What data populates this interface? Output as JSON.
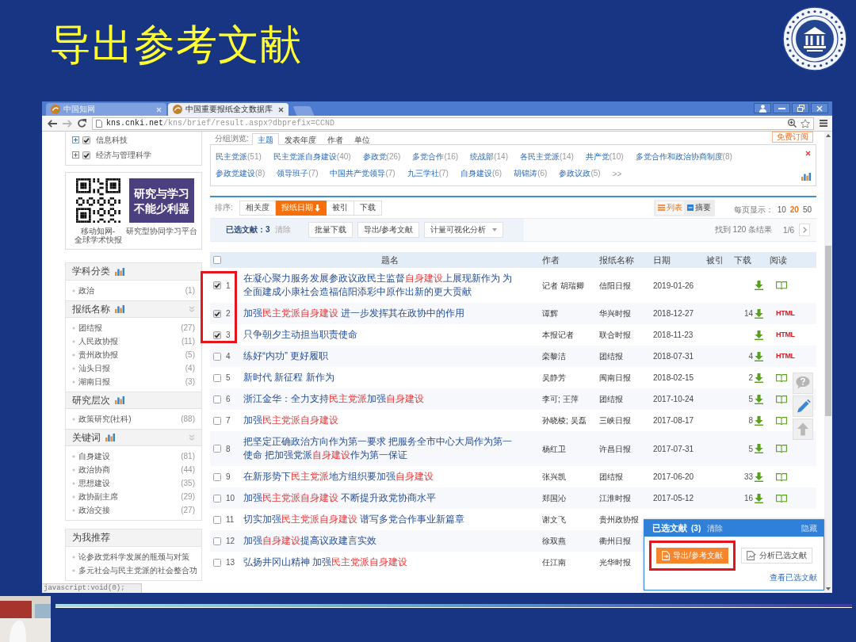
{
  "slide": {
    "title": "导出参考文献"
  },
  "browser": {
    "tabs": [
      {
        "title": "中国知网",
        "selected": false
      },
      {
        "title": "中国重要报纸全文数据库",
        "selected": true
      }
    ],
    "url": {
      "host": "kns.cnki.net",
      "path": "/kns/brief/result.aspx?dbprefix=CCND"
    },
    "status_text": "javascript:void(0);"
  },
  "sidebar": {
    "categories": [
      {
        "label": "信息科技",
        "checked": true
      },
      {
        "label": "经济与管理科学",
        "checked": true
      }
    ],
    "promo": {
      "qr_caption": [
        "移动知网-",
        "全球学术快报"
      ],
      "banner": [
        "研究与学习",
        "不能少利器"
      ],
      "banner_caption": "研究型协同学习平台"
    },
    "facets": [
      {
        "title": "学科分类",
        "toggle": false,
        "items": [
          {
            "label": "政治",
            "count": "(1)"
          }
        ]
      },
      {
        "title": "报纸名称",
        "toggle": true,
        "items": [
          {
            "label": "团结报",
            "count": "(27)"
          },
          {
            "label": "人民政协报",
            "count": "(11)"
          },
          {
            "label": "贵州政协报",
            "count": "(5)"
          },
          {
            "label": "汕头日报",
            "count": "(4)"
          },
          {
            "label": "湖南日报",
            "count": "(3)"
          }
        ]
      },
      {
        "title": "研究层次",
        "toggle": false,
        "items": [
          {
            "label": "政策研究(社科)",
            "count": "(88)"
          }
        ]
      },
      {
        "title": "关键词",
        "toggle": true,
        "items": [
          {
            "label": "自身建设",
            "count": "(81)"
          },
          {
            "label": "政治协商",
            "count": "(44)"
          },
          {
            "label": "思想建设",
            "count": "(35)"
          },
          {
            "label": "政协副主席",
            "count": "(29)"
          },
          {
            "label": "政治交接",
            "count": "(27)"
          }
        ]
      }
    ],
    "recommend": {
      "title": "为我推荐",
      "items": [
        "论参政党科学发展的瓶颈与对策",
        "多元社会与民主党派的社会整合功"
      ]
    }
  },
  "group_browse": {
    "label": "分组浏览:",
    "tabs": [
      {
        "label": "主题",
        "selected": true
      },
      {
        "label": "发表年度",
        "selected": false
      },
      {
        "label": "作者",
        "selected": false
      },
      {
        "label": "单位",
        "selected": false
      }
    ],
    "subscribe": "免费订阅"
  },
  "topics": {
    "rows": [
      [
        {
          "label": "民主党派",
          "count": "(51)"
        },
        {
          "label": "民主党派自身建设",
          "count": "(40)"
        },
        {
          "label": "参政党",
          "count": "(26)"
        },
        {
          "label": "多党合作",
          "count": "(16)"
        },
        {
          "label": "统战部",
          "count": "(14)"
        },
        {
          "label": "各民主党派",
          "count": "(14)"
        },
        {
          "label": "共产党",
          "count": "(10)"
        },
        {
          "label": "多党合作和政治协商制度",
          "count": "(8)"
        }
      ],
      [
        {
          "label": "参政党建设",
          "count": "(8)"
        },
        {
          "label": "领导班子",
          "count": "(7)"
        },
        {
          "label": "中国共产党领导",
          "count": "(7)"
        },
        {
          "label": "九三学社",
          "count": "(7)"
        },
        {
          "label": "自身建设",
          "count": "(6)"
        },
        {
          "label": "胡锦涛",
          "count": "(6)"
        },
        {
          "label": "参政议政",
          "count": "(5)"
        }
      ]
    ],
    "more": ">>"
  },
  "sort": {
    "label": "排序:",
    "options": [
      {
        "label": "相关度",
        "selected": false
      },
      {
        "label": "报纸日期",
        "selected": true
      },
      {
        "label": "被引",
        "selected": false
      },
      {
        "label": "下载",
        "selected": false
      }
    ]
  },
  "views": [
    {
      "label": "列表",
      "kind": "list",
      "selected": true
    },
    {
      "label": "摘要",
      "kind": "abstract",
      "selected": false
    }
  ],
  "page_size": {
    "label": "每页显示：",
    "options": [
      {
        "label": "10",
        "selected": false
      },
      {
        "label": "20",
        "selected": true
      },
      {
        "label": "50",
        "selected": false
      }
    ]
  },
  "selection": {
    "label": "已选文献：3",
    "clear": "清除",
    "actions": [
      {
        "label": "批量下载",
        "dropdown": false
      },
      {
        "label": "导出/参考文献",
        "dropdown": false
      },
      {
        "label": "计量可视化分析",
        "dropdown": true
      }
    ],
    "results": "找到 120 条结果",
    "page": "1/6"
  },
  "table": {
    "columns": [
      "题名",
      "作者",
      "报纸名称",
      "日期",
      "被引",
      "下载",
      "阅读"
    ],
    "all_checked": false,
    "rows": [
      {
        "no": "1",
        "checked": true,
        "framed": true,
        "title": "在凝心聚力服务发展参政议政民主监督**自身建设**上展现新作为 为全面建成小康社会造福信阳添彩中原作出新的更大贡献",
        "author": "记者 胡瑞卿",
        "paper": "信阳日报",
        "date": "2019-01-26",
        "downloadable": true,
        "read": {
          "kind": "book"
        }
      },
      {
        "no": "2",
        "checked": true,
        "framed": true,
        "title": "加强**民主党派自身建设** 进一步发挥其在政协中的作用",
        "author": "谭辉",
        "paper": "华兴时报",
        "date": "2018-12-27",
        "downloads": "14",
        "downloadable": true,
        "read": {
          "kind": "html",
          "label": "HTML"
        }
      },
      {
        "no": "3",
        "checked": true,
        "framed": true,
        "title": "只争朝夕主动担当职责使命",
        "author": "本报记者",
        "paper": "联合时报",
        "date": "2018-11-23",
        "downloadable": true,
        "read": {
          "kind": "html",
          "label": "HTML"
        }
      },
      {
        "no": "4",
        "checked": false,
        "framed": false,
        "title": "练好“内功” 更好履职",
        "author": "栾黎洁",
        "paper": "团结报",
        "date": "2018-07-31",
        "downloads": "4",
        "downloadable": true,
        "read": {
          "kind": "html",
          "label": "HTML"
        }
      },
      {
        "no": "5",
        "checked": false,
        "framed": false,
        "title": "新时代 新征程 新作为",
        "author": "吴静芳",
        "paper": "闽南日报",
        "date": "2018-02-15",
        "downloads": "2",
        "downloadable": true,
        "read": {
          "kind": "book"
        }
      },
      {
        "no": "6",
        "checked": false,
        "framed": false,
        "title": "浙江金华：全力支持**民主党派**加强**自身建设**",
        "author": "李可; 王萍",
        "paper": "团结报",
        "date": "2017-10-24",
        "downloads": "5",
        "downloadable": true,
        "read": {
          "kind": "book"
        }
      },
      {
        "no": "7",
        "checked": false,
        "framed": false,
        "title": "加强**民主党派自身建设**",
        "author": "孙晓棱; 吴磊",
        "paper": "三峡日报",
        "date": "2017-08-17",
        "downloads": "8",
        "downloadable": true,
        "read": {
          "kind": "book"
        }
      },
      {
        "no": "8",
        "checked": false,
        "framed": false,
        "title": "把坚定正确政治方向作为第一要求 把服务全市中心大局作为第一使命 把加强党派**自身建设**作为第一保证",
        "author": "杨红卫",
        "paper": "许昌日报",
        "date": "2017-07-31",
        "downloads": "5",
        "downloadable": true,
        "read": {
          "kind": "book"
        }
      },
      {
        "no": "9",
        "checked": false,
        "framed": false,
        "title": "在新形势下**民主党派**地方组织要加强**自身建设**",
        "author": "张兴凯",
        "paper": "团结报",
        "date": "2017-06-20",
        "downloads": "33",
        "downloadable": true,
        "read": {
          "kind": "book"
        }
      },
      {
        "no": "10",
        "checked": false,
        "framed": false,
        "title": "加强**民主党派自身建设** 不断提升政党协商水平",
        "author": "郑国沁",
        "paper": "江淮时报",
        "date": "2017-05-12",
        "downloads": "16",
        "downloadable": true,
        "read": {
          "kind": "book"
        }
      },
      {
        "no": "11",
        "checked": false,
        "framed": false,
        "title": "切实加强**民主党派自身建设** 谱写多党合作事业新篇章",
        "author": "谢文飞",
        "paper": "贵州政协报"
      },
      {
        "no": "12",
        "checked": false,
        "framed": false,
        "title": "加强**自身建设**提高议政建言实效",
        "author": "徐双燕",
        "paper": "衢州日报"
      },
      {
        "no": "13",
        "checked": false,
        "framed": false,
        "title": "弘扬井冈山精神 加强**民主党派自身建设**",
        "author": "任江南",
        "paper": "光华时报"
      }
    ]
  },
  "selected_panel": {
    "title": "已选文献",
    "count": "(3)",
    "clear": "清除",
    "hide": "隐藏",
    "buttons": [
      {
        "label": "导出/参考文献",
        "kind": "export",
        "primary": true,
        "framed": true
      },
      {
        "label": "分析已选文献",
        "kind": "analyze",
        "primary": false,
        "framed": false
      }
    ],
    "link": "查看已选文献"
  }
}
